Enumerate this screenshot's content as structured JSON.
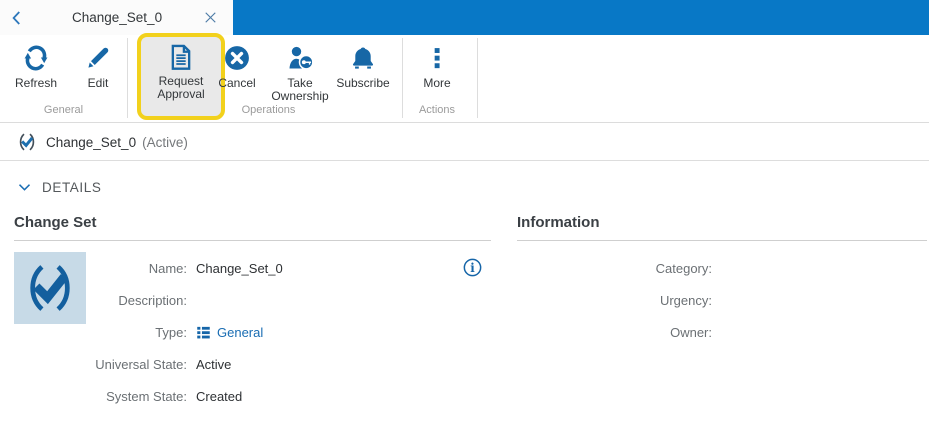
{
  "colors": {
    "top_bar_blue": "#0878c6",
    "icon_blue": "#1767a6",
    "link_blue": "#1a6db3",
    "highlight_yellow": "#f2d11c",
    "thumbnail_bg": "#c7dae7"
  },
  "tab_bar": {
    "title": "Change_Set_0"
  },
  "toolbar": {
    "groups": [
      {
        "label": "General",
        "buttons": [
          {
            "label": "Refresh",
            "icon": "refresh-icon"
          },
          {
            "label": "Edit",
            "icon": "edit-icon"
          }
        ]
      },
      {
        "label": "Operations",
        "buttons": [
          {
            "label": "Request Approval",
            "icon": "request-approval-icon",
            "highlighted": true
          },
          {
            "label": "Cancel",
            "icon": "cancel-icon"
          },
          {
            "label": "Take Ownership",
            "icon": "take-ownership-icon"
          },
          {
            "label": "Subscribe",
            "icon": "subscribe-icon"
          }
        ]
      },
      {
        "label": "Actions",
        "buttons": [
          {
            "label": "More",
            "icon": "more-icon"
          }
        ]
      }
    ]
  },
  "status_bar": {
    "name": "Change_Set_0",
    "state": "(Active)"
  },
  "details": {
    "section_label": "DETAILS",
    "change_set": {
      "header": "Change Set",
      "fields": [
        {
          "label": "Name:",
          "value": "Change_Set_0"
        },
        {
          "label": "Description:",
          "value": ""
        },
        {
          "label": "Type:",
          "value": "General"
        },
        {
          "label": "Universal State:",
          "value": "Active"
        },
        {
          "label": "System State:",
          "value": "Created"
        }
      ]
    },
    "information": {
      "header": "Information",
      "fields": [
        {
          "label": "Category:",
          "value": ""
        },
        {
          "label": "Urgency:",
          "value": ""
        },
        {
          "label": "Owner:",
          "value": ""
        }
      ]
    }
  }
}
